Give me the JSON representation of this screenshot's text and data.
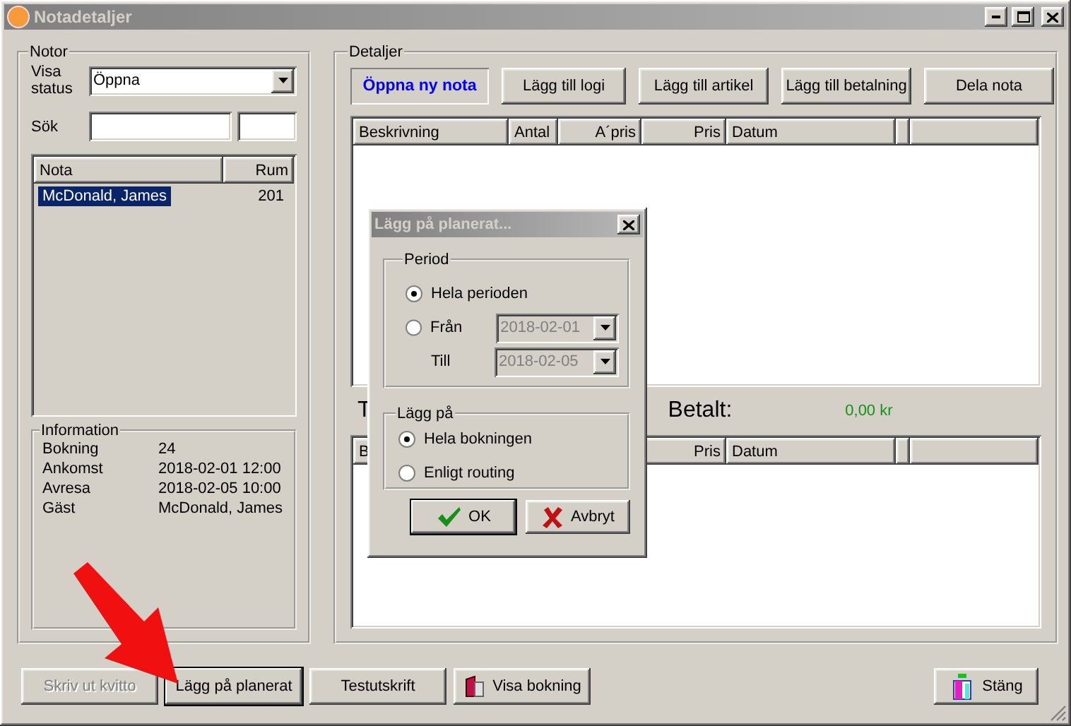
{
  "window": {
    "title": "Notadetaljer"
  },
  "notes_panel": {
    "title": "Notor",
    "status_label": "Visa status",
    "status_value": "Öppna",
    "search_label": "Sök",
    "list": {
      "columns": [
        {
          "label": "Nota"
        },
        {
          "label": "Rum"
        }
      ],
      "rows": [
        {
          "cells": [
            "McDonald, James",
            "201"
          ],
          "selected": true
        }
      ]
    },
    "information": {
      "title": "Information",
      "rows": [
        {
          "label": "Bokning",
          "value": "24"
        },
        {
          "label": "Ankomst",
          "value": "2018-02-01 12:00"
        },
        {
          "label": "Avresa",
          "value": "2018-02-05 10:00"
        },
        {
          "label": "Gäst",
          "value": "McDonald, James"
        }
      ]
    }
  },
  "details_panel": {
    "title": "Detaljer",
    "buttons": [
      {
        "label": "Öppna ny nota",
        "kind": "highlight"
      },
      {
        "label": "Lägg till logi",
        "kind": "normal"
      },
      {
        "label": "Lägg till artikel",
        "kind": "normal"
      },
      {
        "label": "Lägg till betalning",
        "kind": "normal"
      },
      {
        "label": "Dela nota",
        "kind": "normal"
      }
    ],
    "items_table": {
      "columns": [
        {
          "label": "Beskrivning"
        },
        {
          "label": "Antal"
        },
        {
          "label": "A´pris"
        },
        {
          "label": "Pris"
        },
        {
          "label": "Datum"
        }
      ]
    },
    "totals": {
      "label": "T",
      "paid_label": "Betalt:",
      "paid_value": "0,00 kr"
    },
    "payments_table": {
      "columns": [
        {
          "label": "B"
        },
        {
          "label": "Pris"
        },
        {
          "label": "Datum"
        }
      ]
    }
  },
  "bottom_buttons": [
    {
      "label": "Skriv ut kvitto",
      "disabled": true,
      "default": false,
      "kind": "plain"
    },
    {
      "label": "Lägg på planerat",
      "disabled": false,
      "default": true,
      "kind": "plain"
    },
    {
      "label": "Testutskrift",
      "disabled": false,
      "default": false,
      "kind": "plain"
    },
    {
      "label": "Visa bokning",
      "disabled": false,
      "default": false,
      "kind": "book"
    },
    {
      "label": "Stäng",
      "disabled": false,
      "default": false,
      "kind": "exit"
    }
  ],
  "pointer_arrow": true,
  "dialog": {
    "title": "Lägg på planerat...",
    "period": {
      "title": "Period",
      "options": [
        {
          "label": "Hela perioden",
          "selected": true
        },
        {
          "label": "Från",
          "selected": false,
          "date": "2018-02-01"
        }
      ],
      "to": {
        "label": "Till",
        "date": "2018-02-05"
      },
      "dates_disabled": true
    },
    "apply_to": {
      "title": "Lägg på",
      "options": [
        {
          "label": "Hela bokningen",
          "selected": true
        },
        {
          "label": "Enligt routing",
          "selected": false
        }
      ]
    },
    "buttons": [
      {
        "label": "OK",
        "kind": "check",
        "default": true
      },
      {
        "label": "Avbryt",
        "kind": "cross",
        "default": false
      }
    ]
  }
}
